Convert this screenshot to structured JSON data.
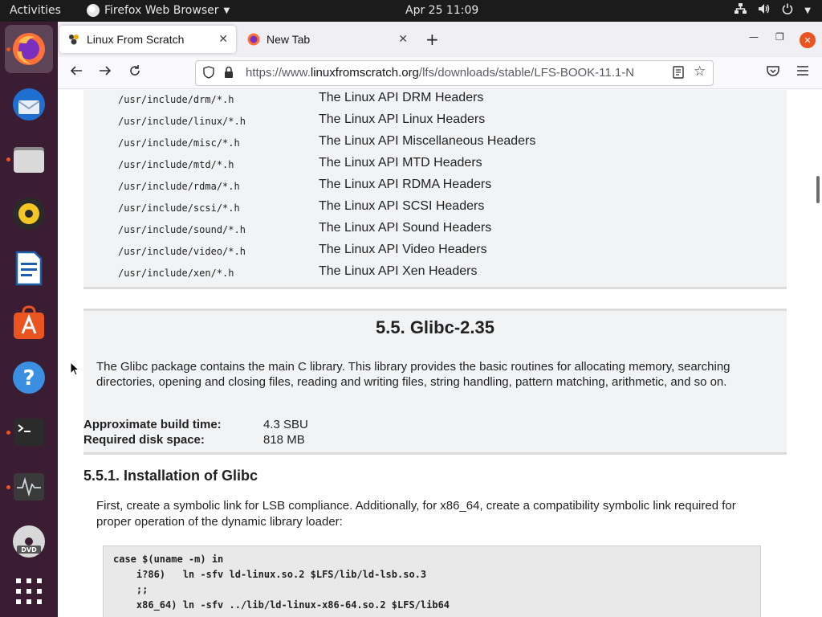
{
  "topbar": {
    "activities": "Activities",
    "app_name": "Firefox Web Browser",
    "datetime": "Apr 25  11:09"
  },
  "dock": {
    "items": [
      "firefox",
      "thunderbird",
      "files",
      "rhythmbox",
      "libreoffice-writer",
      "ubuntu-software",
      "help",
      "terminal",
      "system-monitor",
      "dvd",
      "show-applications"
    ]
  },
  "browser": {
    "tabs": [
      {
        "title": "Linux From Scratch"
      },
      {
        "title": "New Tab"
      }
    ],
    "url_prefix": "https://www.",
    "url_host": "linuxfromscratch.org",
    "url_path": "/lfs/downloads/stable/LFS-BOOK-11.1-N"
  },
  "page": {
    "headers_table": [
      {
        "path": "/usr/include/drm/*.h",
        "desc": "The Linux API DRM Headers"
      },
      {
        "path": "/usr/include/linux/*.h",
        "desc": "The Linux API Linux Headers"
      },
      {
        "path": "/usr/include/misc/*.h",
        "desc": "The Linux API Miscellaneous Headers"
      },
      {
        "path": "/usr/include/mtd/*.h",
        "desc": "The Linux API MTD Headers"
      },
      {
        "path": "/usr/include/rdma/*.h",
        "desc": "The Linux API RDMA Headers"
      },
      {
        "path": "/usr/include/scsi/*.h",
        "desc": "The Linux API SCSI Headers"
      },
      {
        "path": "/usr/include/sound/*.h",
        "desc": "The Linux API Sound Headers"
      },
      {
        "path": "/usr/include/video/*.h",
        "desc": "The Linux API Video Headers"
      },
      {
        "path": "/usr/include/xen/*.h",
        "desc": "The Linux API Xen Headers"
      }
    ],
    "section_title": "5.5. Glibc-2.35",
    "section_intro": "The Glibc package contains the main C library. This library provides the basic routines for allocating memory, searching directories, opening and closing files, reading and writing files, string handling, pattern matching, arithmetic, and so on.",
    "build_time_label": "Approximate build time:",
    "build_time_value": "4.3 SBU",
    "disk_space_label": "Required disk space:",
    "disk_space_value": "818 MB",
    "subsection_title": "5.5.1. Installation of Glibc",
    "subsection_text": "First, create a symbolic link for LSB compliance. Additionally, for x86_64, create a compatibility symbolic link required for proper operation of the dynamic library loader:",
    "code_lines": [
      "case $(uname -m) in",
      "    i?86)   ln -sfv ld-linux.so.2 $LFS/lib/ld-lsb.so.3",
      "    ;;",
      "    x86_64) ln -sfv ../lib/ld-linux-x86-64.so.2 $LFS/lib64"
    ]
  }
}
